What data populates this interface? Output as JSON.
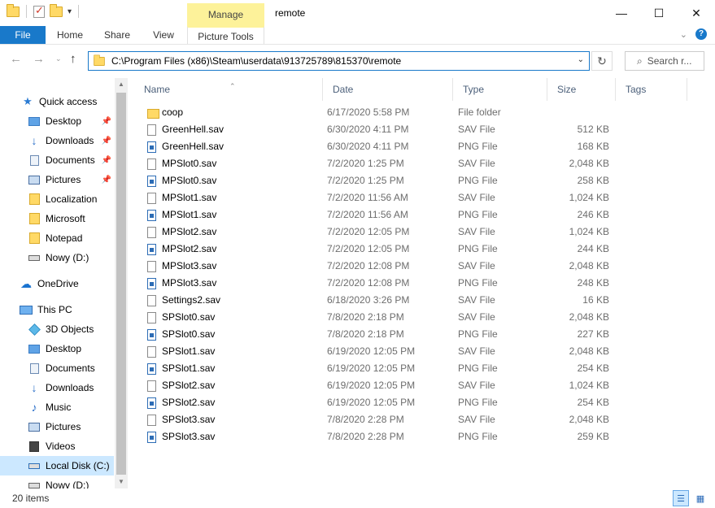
{
  "window": {
    "title": "remote",
    "context_tab": "Manage",
    "controls": {
      "minimize": "—",
      "maximize": "☐",
      "close": "✕"
    }
  },
  "ribbon": {
    "tabs": [
      "File",
      "Home",
      "Share",
      "View",
      "Picture Tools"
    ],
    "expand": "⌄",
    "help": "?"
  },
  "address": {
    "path": "C:\\Program Files (x86)\\Steam\\userdata\\913725789\\815370\\remote",
    "search_placeholder": "Search r..."
  },
  "nav": {
    "quick_access": "Quick access",
    "pinned": [
      "Desktop",
      "Downloads",
      "Documents",
      "Pictures"
    ],
    "recent": [
      "Localization",
      "Microsoft",
      "Notepad",
      "Nowy (D:)"
    ],
    "onedrive": "OneDrive",
    "this_pc": "This PC",
    "pc_items": [
      "3D Objects",
      "Desktop",
      "Documents",
      "Downloads",
      "Music",
      "Pictures",
      "Videos",
      "Local Disk (C:)",
      "Nowy (D:)"
    ]
  },
  "columns": {
    "name": "Name",
    "date": "Date",
    "type": "Type",
    "size": "Size",
    "tags": "Tags"
  },
  "files": [
    {
      "name": "coop",
      "date": "6/17/2020 5:58 PM",
      "type": "File folder",
      "size": "",
      "icon": "folder-icon"
    },
    {
      "name": "GreenHell.sav",
      "date": "6/30/2020 4:11 PM",
      "type": "SAV File",
      "size": "512 KB",
      "icon": "sav-file-icon"
    },
    {
      "name": "GreenHell.sav",
      "date": "6/30/2020 4:11 PM",
      "type": "PNG File",
      "size": "168 KB",
      "icon": "png-file-icon"
    },
    {
      "name": "MPSlot0.sav",
      "date": "7/2/2020 1:25 PM",
      "type": "SAV File",
      "size": "2,048 KB",
      "icon": "sav-file-icon"
    },
    {
      "name": "MPSlot0.sav",
      "date": "7/2/2020 1:25 PM",
      "type": "PNG File",
      "size": "258 KB",
      "icon": "png-file-icon"
    },
    {
      "name": "MPSlot1.sav",
      "date": "7/2/2020 11:56 AM",
      "type": "SAV File",
      "size": "1,024 KB",
      "icon": "sav-file-icon"
    },
    {
      "name": "MPSlot1.sav",
      "date": "7/2/2020 11:56 AM",
      "type": "PNG File",
      "size": "246 KB",
      "icon": "png-file-icon"
    },
    {
      "name": "MPSlot2.sav",
      "date": "7/2/2020 12:05 PM",
      "type": "SAV File",
      "size": "1,024 KB",
      "icon": "sav-file-icon"
    },
    {
      "name": "MPSlot2.sav",
      "date": "7/2/2020 12:05 PM",
      "type": "PNG File",
      "size": "244 KB",
      "icon": "png-file-icon"
    },
    {
      "name": "MPSlot3.sav",
      "date": "7/2/2020 12:08 PM",
      "type": "SAV File",
      "size": "2,048 KB",
      "icon": "sav-file-icon"
    },
    {
      "name": "MPSlot3.sav",
      "date": "7/2/2020 12:08 PM",
      "type": "PNG File",
      "size": "248 KB",
      "icon": "png-file-icon"
    },
    {
      "name": "Settings2.sav",
      "date": "6/18/2020 3:26 PM",
      "type": "SAV File",
      "size": "16 KB",
      "icon": "sav-file-icon"
    },
    {
      "name": "SPSlot0.sav",
      "date": "7/8/2020 2:18 PM",
      "type": "SAV File",
      "size": "2,048 KB",
      "icon": "sav-file-icon"
    },
    {
      "name": "SPSlot0.sav",
      "date": "7/8/2020 2:18 PM",
      "type": "PNG File",
      "size": "227 KB",
      "icon": "png-file-icon"
    },
    {
      "name": "SPSlot1.sav",
      "date": "6/19/2020 12:05 PM",
      "type": "SAV File",
      "size": "2,048 KB",
      "icon": "sav-file-icon"
    },
    {
      "name": "SPSlot1.sav",
      "date": "6/19/2020 12:05 PM",
      "type": "PNG File",
      "size": "254 KB",
      "icon": "png-file-icon"
    },
    {
      "name": "SPSlot2.sav",
      "date": "6/19/2020 12:05 PM",
      "type": "SAV File",
      "size": "1,024 KB",
      "icon": "sav-file-icon"
    },
    {
      "name": "SPSlot2.sav",
      "date": "6/19/2020 12:05 PM",
      "type": "PNG File",
      "size": "254 KB",
      "icon": "png-file-icon"
    },
    {
      "name": "SPSlot3.sav",
      "date": "7/8/2020 2:28 PM",
      "type": "SAV File",
      "size": "2,048 KB",
      "icon": "sav-file-icon"
    },
    {
      "name": "SPSlot3.sav",
      "date": "7/8/2020 2:28 PM",
      "type": "PNG File",
      "size": "259 KB",
      "icon": "png-file-icon"
    }
  ],
  "status": {
    "item_count": "20 items"
  },
  "colors": {
    "accent": "#1979ca",
    "manage_tab": "#fdf29a",
    "selection": "#cce8ff"
  }
}
